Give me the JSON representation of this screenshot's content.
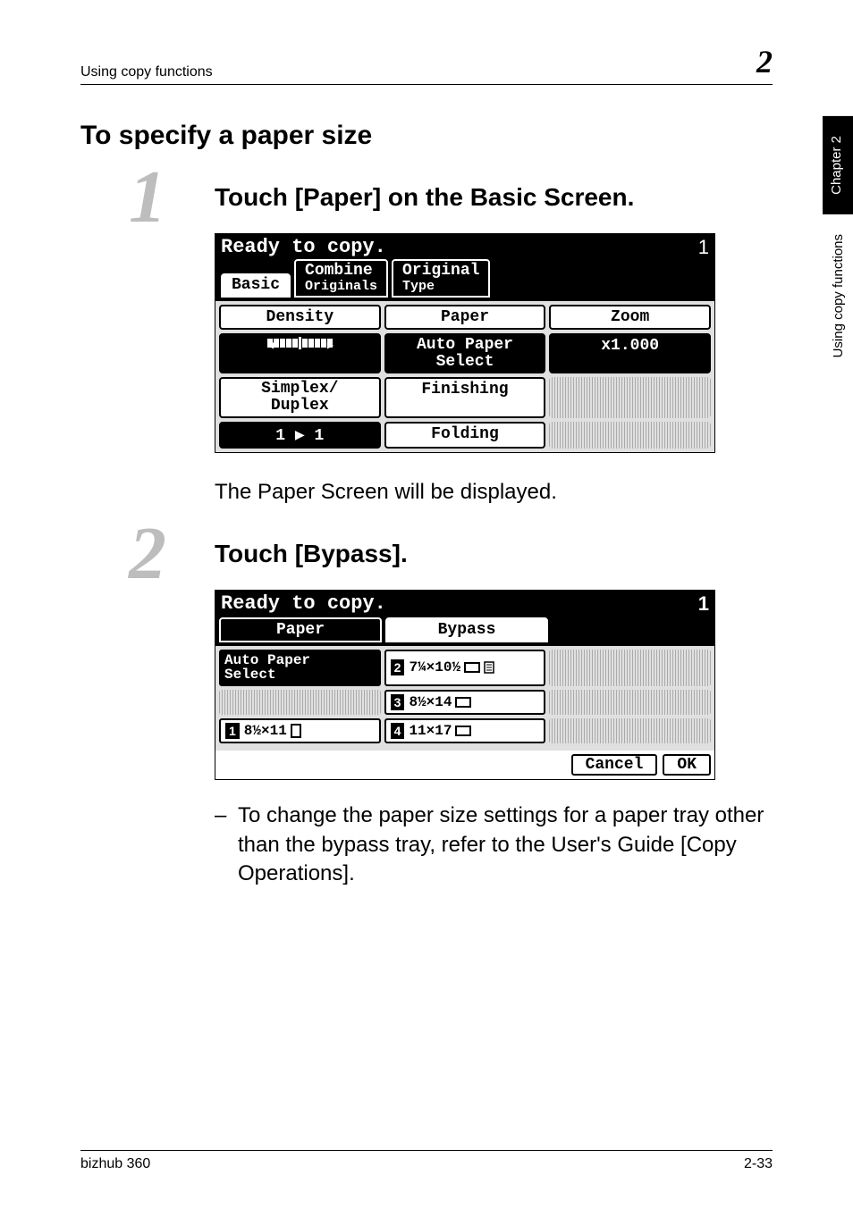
{
  "header": {
    "left": "Using copy functions",
    "right": "2"
  },
  "sidetab": {
    "dark": "Chapter 2",
    "light": "Using copy functions"
  },
  "section_title": "To specify a paper size",
  "steps": [
    {
      "num": "1",
      "heading": "Touch [Paper] on the Basic Screen.",
      "after_text": "The Paper Screen will be displayed."
    },
    {
      "num": "2",
      "heading": "Touch [Bypass].",
      "bullet": "To change the paper size settings for a paper tray other than the bypass tray, refer to the User's Guide [Copy Operations]."
    }
  ],
  "screen1": {
    "ready": "Ready to copy.",
    "count": "1",
    "tabs": {
      "basic": "Basic",
      "combine": "Combine",
      "originals": "Originals",
      "original": "Original",
      "type": "Type"
    },
    "cells": {
      "density": "Density",
      "paper": "Paper",
      "zoom": "Zoom",
      "auto_paper_select": "Auto Paper\nSelect",
      "zoom_val": "x1.000",
      "simplex_duplex": "Simplex/\nDuplex",
      "finishing": "Finishing",
      "one_to_one": "1 ▶ 1",
      "folding": "Folding"
    }
  },
  "screen2": {
    "ready": "Ready to copy.",
    "count": "1",
    "tabs": {
      "paper": "Paper",
      "bypass": "Bypass"
    },
    "items": {
      "auto": "Auto Paper\nSelect",
      "i1": "8½×11",
      "i2": "7¼×10½",
      "i3": "8½×14",
      "i4": "11×17"
    },
    "buttons": {
      "cancel": "Cancel",
      "ok": "OK"
    }
  },
  "footer": {
    "left": "bizhub 360",
    "right": "2-33"
  }
}
